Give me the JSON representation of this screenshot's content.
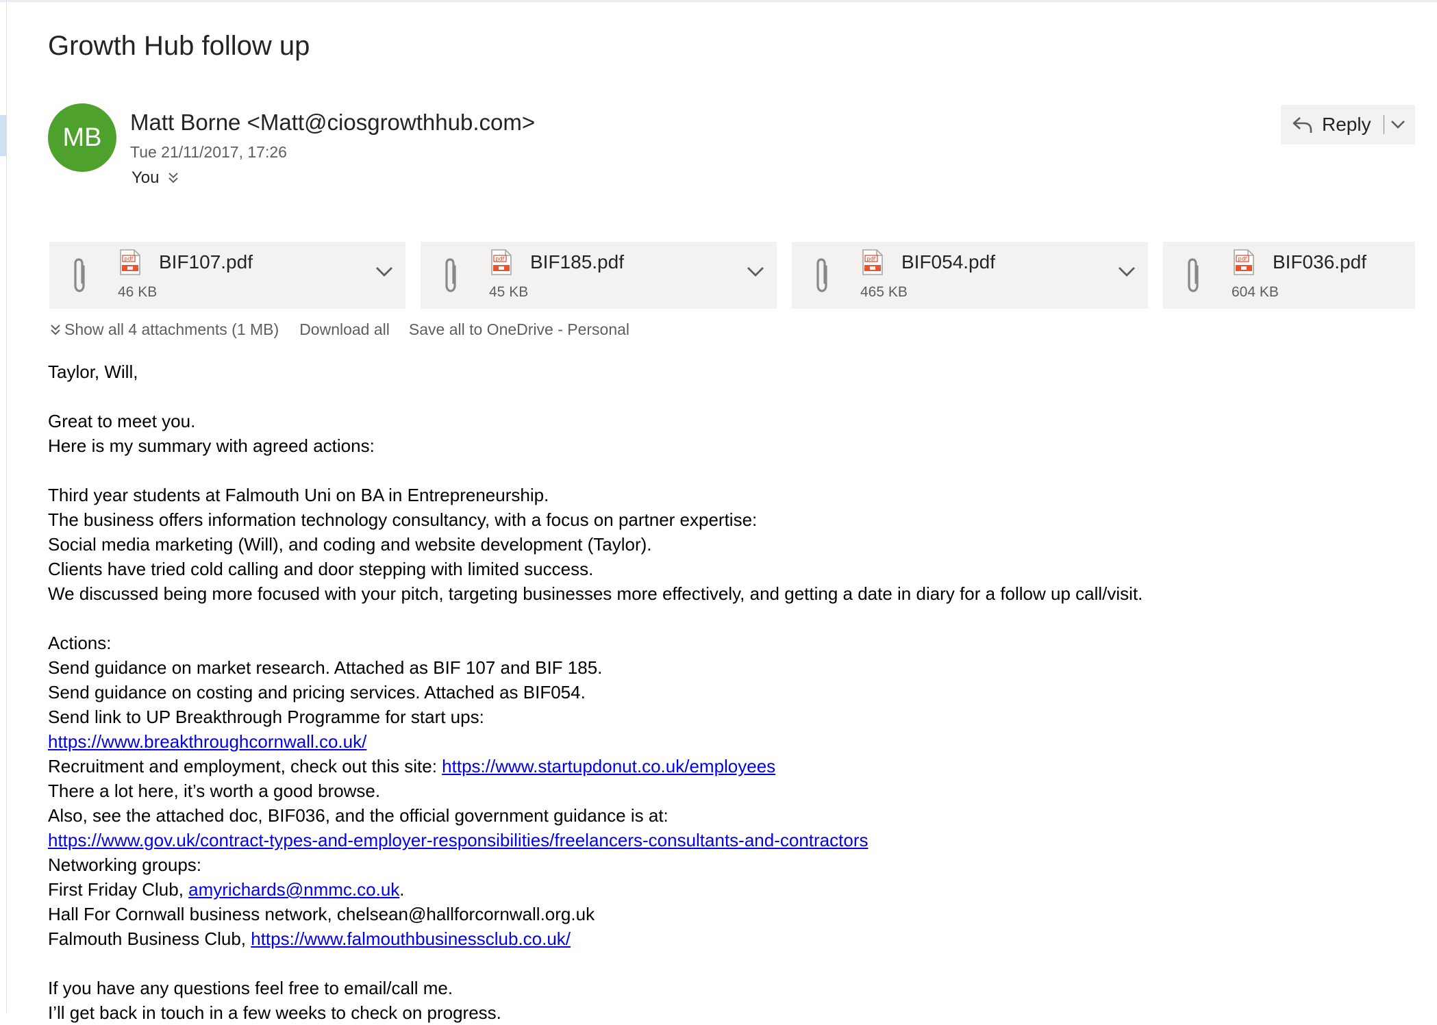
{
  "message": {
    "subject": "Growth Hub follow up",
    "avatar_initials": "MB",
    "avatar_color": "#4ea12c",
    "sender": "Matt Borne <Matt@ciosgrowthhub.com>",
    "date": "Tue 21/11/2017, 17:26",
    "to": "You"
  },
  "reply": {
    "label": "Reply"
  },
  "attachments": [
    {
      "name": "BIF107.pdf",
      "size": "46 KB"
    },
    {
      "name": "BIF185.pdf",
      "size": "45 KB"
    },
    {
      "name": "BIF054.pdf",
      "size": "465 KB"
    },
    {
      "name": "BIF036.pdf",
      "size": "604 KB"
    }
  ],
  "attachment_actions": {
    "show_all": "Show all 4 attachments (1 MB)",
    "download_all": "Download all",
    "save_onedrive": "Save all to OneDrive - Personal"
  },
  "body": {
    "greeting": "Taylor, Will,",
    "p1": "Great to meet you.",
    "p2": "Here is my summary with agreed actions:",
    "s1": "Third year students at Falmouth Uni on BA in Entrepreneurship.",
    "s2": "The business offers information technology consultancy, with a focus on partner expertise:",
    "s3": "Social media marketing (Will), and coding and website development (Taylor).",
    "s4": "Clients have tried cold calling and door stepping with limited success.",
    "s5": "We discussed being more focused with your pitch, targeting businesses more effectively, and getting a date in diary for a follow up call/visit.",
    "actions_heading": "Actions:",
    "a1": "Send guidance on market research. Attached as BIF 107 and BIF 185.",
    "a2": "Send guidance on costing and pricing services. Attached as BIF054.",
    "a3": "Send link to UP Breakthrough Programme for start ups:",
    "link_breakthrough": "https://www.breakthroughcornwall.co.uk/",
    "a4_prefix": "Recruitment and employment, check out this site: ",
    "link_startupdonut": "https://www.startupdonut.co.uk/employees",
    "a5": "There a lot here, it’s worth a good browse.",
    "a6": "Also, see the attached doc, BIF036, and the official government guidance is at:",
    "link_gov": "https://www.gov.uk/contract-types-and-employer-responsibilities/freelancers-consultants-and-contractors",
    "networking_heading": "Networking groups:",
    "n1_prefix": "First Friday Club, ",
    "link_amy": "amyrichards@nmmc.co.uk",
    "n1_suffix": ".",
    "n2": "Hall For Cornwall business network, chelsean@hallforcornwall.org.uk",
    "n3_prefix": "Falmouth Business Club, ",
    "link_falmouth": "https://www.falmouthbusinessclub.co.uk/",
    "closing1": "If you have any questions feel free to email/call me.",
    "closing2": "I’ll get back in touch in a few weeks to check on progress."
  }
}
